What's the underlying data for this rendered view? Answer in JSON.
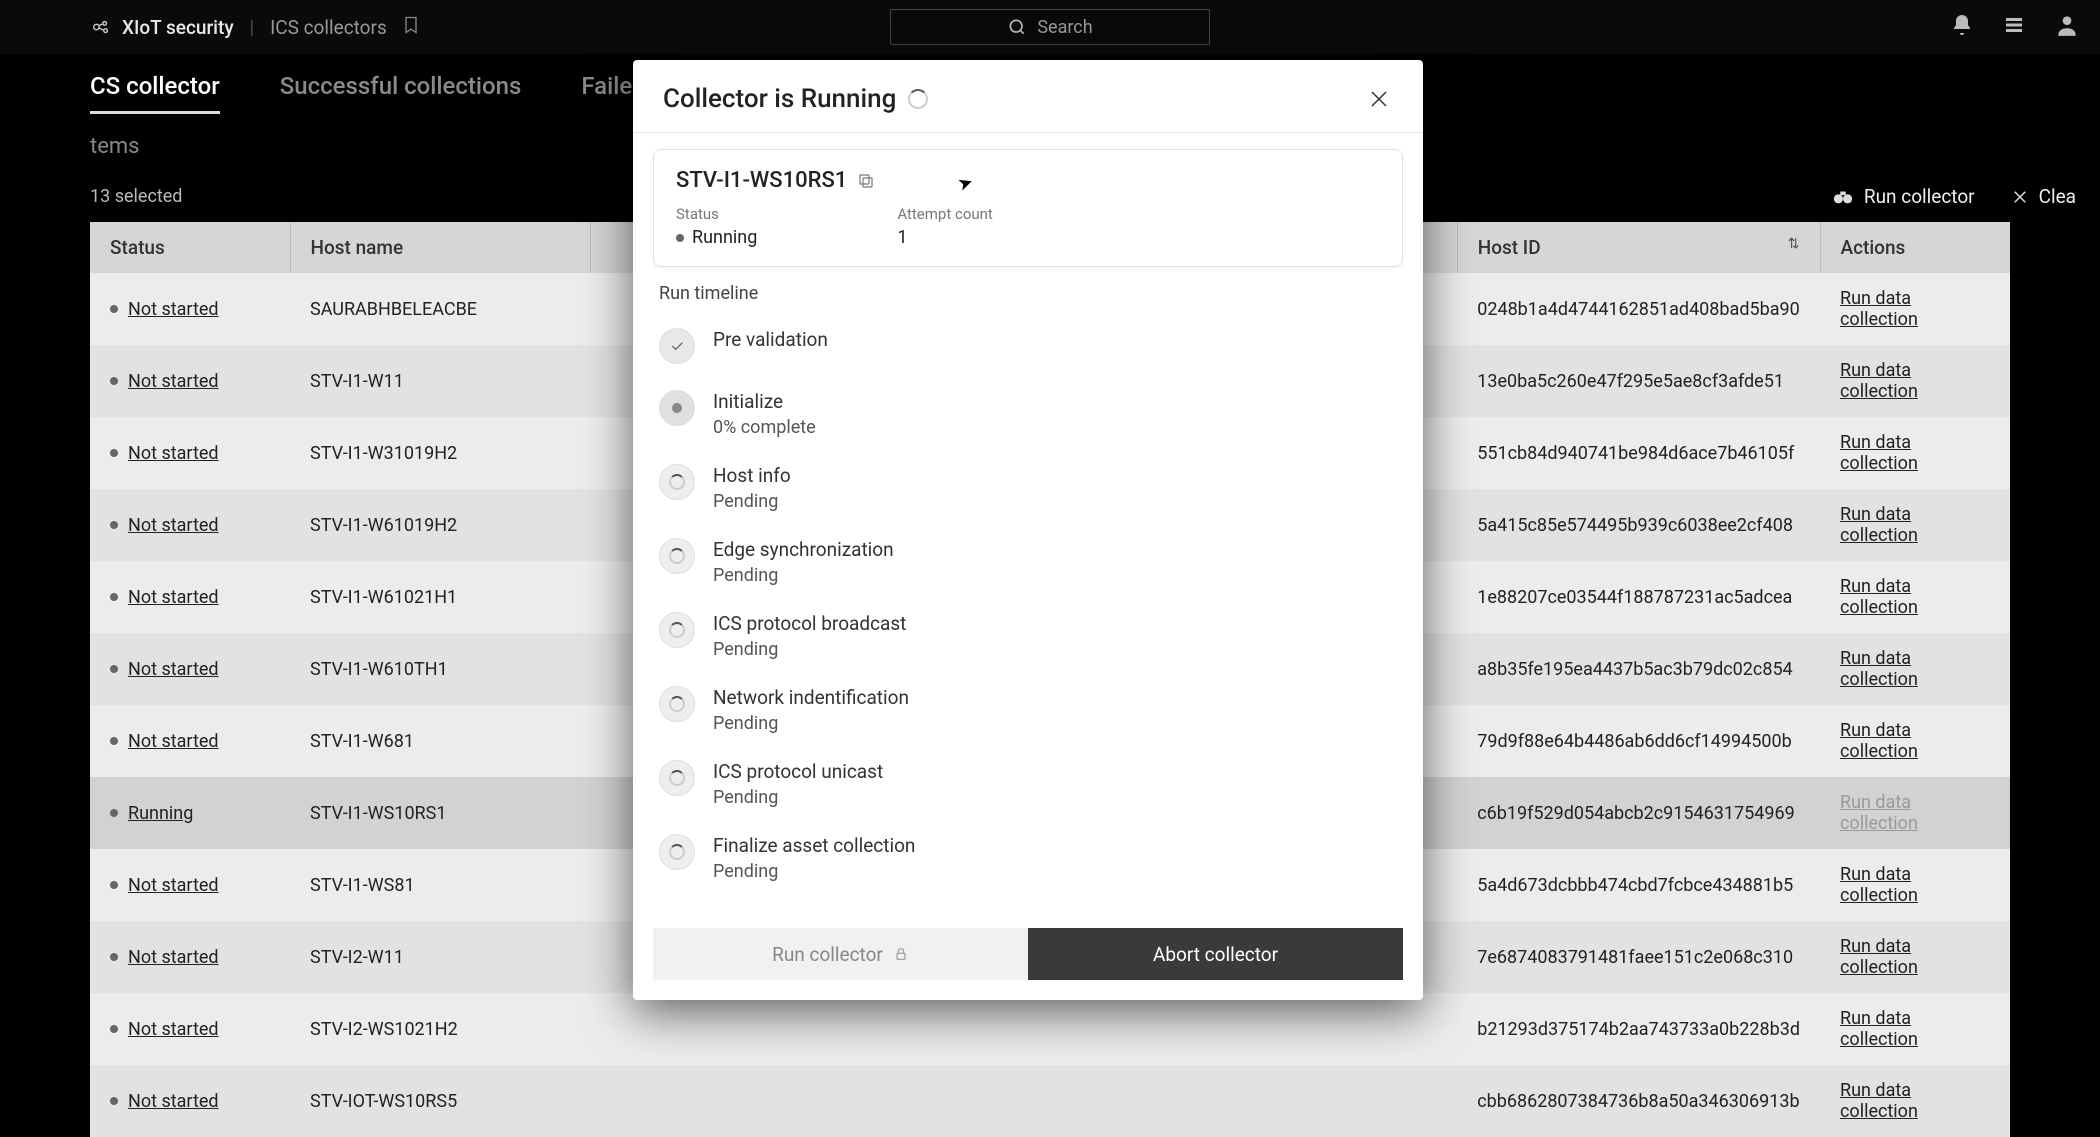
{
  "app": {
    "title": "XIoT security"
  },
  "breadcrumb": {
    "item": "ICS collectors"
  },
  "search": {
    "placeholder": "Search"
  },
  "tabs": {
    "cs": "CS collector",
    "successful": "Successful collections",
    "failed": "Failed c"
  },
  "subhead": "tems",
  "selected": "13 selected",
  "toolbar": {
    "run": "Run collector",
    "clear": "Clea"
  },
  "columns": {
    "status": "Status",
    "hostname": "Host name",
    "hostid": "Host ID",
    "actions": "Actions"
  },
  "rows": [
    {
      "status": "Not started",
      "hostname": "SAURABHBELEACBE",
      "hostid": "0248b1a4d4744162851ad408bad5ba90",
      "action": "Run data collection",
      "state": "idle"
    },
    {
      "status": "Not started",
      "hostname": "STV-I1-W11",
      "hostid": "13e0ba5c260e47f295e5ae8cf3afde51",
      "action": "Run data collection",
      "state": "idle"
    },
    {
      "status": "Not started",
      "hostname": "STV-I1-W31019H2",
      "hostid": "551cb84d940741be984d6ace7b46105f",
      "action": "Run data collection",
      "state": "idle"
    },
    {
      "status": "Not started",
      "hostname": "STV-I1-W61019H2",
      "hostid": "5a415c85e574495b939c6038ee2cf408",
      "action": "Run data collection",
      "state": "idle"
    },
    {
      "status": "Not started",
      "hostname": "STV-I1-W61021H1",
      "hostid": "1e88207ce03544f188787231ac5adcea",
      "action": "Run data collection",
      "state": "idle"
    },
    {
      "status": "Not started",
      "hostname": "STV-I1-W610TH1",
      "hostid": "a8b35fe195ea4437b5ac3b79dc02c854",
      "action": "Run data collection",
      "state": "idle"
    },
    {
      "status": "Not started",
      "hostname": "STV-I1-W681",
      "hostid": "79d9f88e64b4486ab6dd6cf14994500b",
      "action": "Run data collection",
      "state": "idle"
    },
    {
      "status": "Running",
      "hostname": "STV-I1-WS10RS1",
      "hostid": "c6b19f529d054abcb2c9154631754969",
      "action": "Run data collection",
      "state": "running"
    },
    {
      "status": "Not started",
      "hostname": "STV-I1-WS81",
      "hostid": "5a4d673dcbbb474cbd7fcbce434881b5",
      "action": "Run data collection",
      "state": "idle"
    },
    {
      "status": "Not started",
      "hostname": "STV-I2-W11",
      "hostid": "7e6874083791481faee151c2e068c310",
      "action": "Run data collection",
      "state": "idle"
    },
    {
      "status": "Not started",
      "hostname": "STV-I2-WS1021H2",
      "hostid": "b21293d375174b2aa743733a0b228b3d",
      "action": "Run data collection",
      "state": "idle"
    },
    {
      "status": "Not started",
      "hostname": "STV-IOT-WS10RS5",
      "hostid": "cbb6862807384736b8a50a346306913b",
      "action": "Run data collection",
      "state": "idle"
    }
  ],
  "modal": {
    "title": "Collector is Running",
    "host": "STV-I1-WS10RS1",
    "status_label": "Status",
    "status_value": "Running",
    "attempt_label": "Attempt count",
    "attempt_value": "1",
    "timeline_title": "Run timeline",
    "steps": [
      {
        "name": "Pre validation",
        "sub": "",
        "state": "done"
      },
      {
        "name": "Initialize",
        "sub": "0% complete",
        "state": "progress"
      },
      {
        "name": "Host info",
        "sub": "Pending",
        "state": "pending"
      },
      {
        "name": "Edge synchronization",
        "sub": "Pending",
        "state": "pending"
      },
      {
        "name": "ICS protocol broadcast",
        "sub": "Pending",
        "state": "pending"
      },
      {
        "name": "Network indentification",
        "sub": "Pending",
        "state": "pending"
      },
      {
        "name": "ICS protocol unicast",
        "sub": "Pending",
        "state": "pending"
      },
      {
        "name": "Finalize asset collection",
        "sub": "Pending",
        "state": "pending"
      }
    ],
    "run_btn": "Run collector",
    "abort_btn": "Abort collector"
  }
}
